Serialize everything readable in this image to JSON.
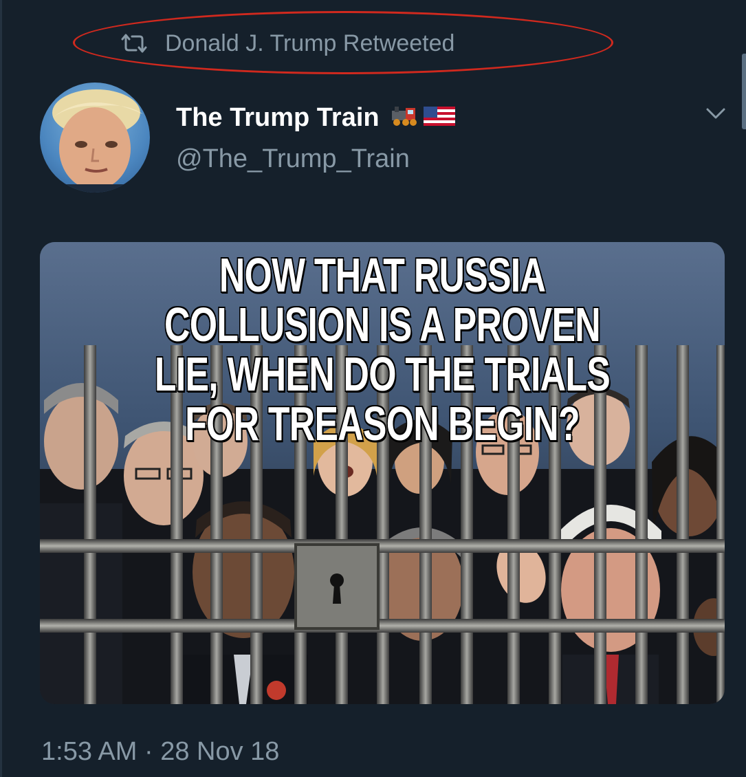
{
  "retweet": {
    "label": "Donald J. Trump Retweeted",
    "icon": "retweet-icon",
    "highlight_color": "#d0291e"
  },
  "tweet": {
    "display_name": "The Trump Train",
    "name_emojis": [
      "locomotive-emoji",
      "us-flag-emoji"
    ],
    "handle": "@The_Trump_Train",
    "media_caption": "NOW THAT RUSSIA COLLUSION IS A PROVEN LIE, WHEN DO THE TRIALS FOR TREASON BEGIN?",
    "timestamp": "1:53 AM · 28 Nov 18"
  },
  "colors": {
    "background": "#15202b",
    "secondary_text": "#8899a6",
    "primary_text": "#ffffff"
  }
}
